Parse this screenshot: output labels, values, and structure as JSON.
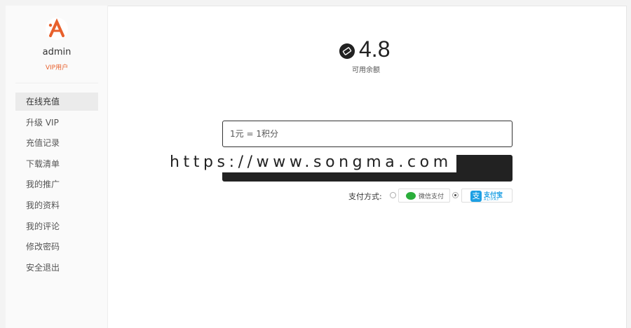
{
  "user": {
    "name": "admin",
    "badge": "VIP用户"
  },
  "sidebar": {
    "items": [
      {
        "label": "在线充值",
        "active": true
      },
      {
        "label": "升级 VIP"
      },
      {
        "label": "充值记录"
      },
      {
        "label": "下载清单"
      },
      {
        "label": "我的推广"
      },
      {
        "label": "我的资料"
      },
      {
        "label": "我的评论"
      },
      {
        "label": "修改密码"
      },
      {
        "label": "安全退出"
      }
    ]
  },
  "balance": {
    "value": "4.8",
    "label": "可用余额"
  },
  "recharge": {
    "placeholder": "1元 = 1积分",
    "watermark": "https://www.songma.com"
  },
  "payment": {
    "label": "支付方式:",
    "options": [
      {
        "label": "微信支付",
        "selected": false
      },
      {
        "label": "支付宝",
        "sub": "ALIPAY",
        "selected": true
      }
    ]
  },
  "colors": {
    "accent": "#e8602c",
    "dark": "#222222",
    "wechat": "#2aae3b",
    "alipay": "#1d9fe3"
  }
}
